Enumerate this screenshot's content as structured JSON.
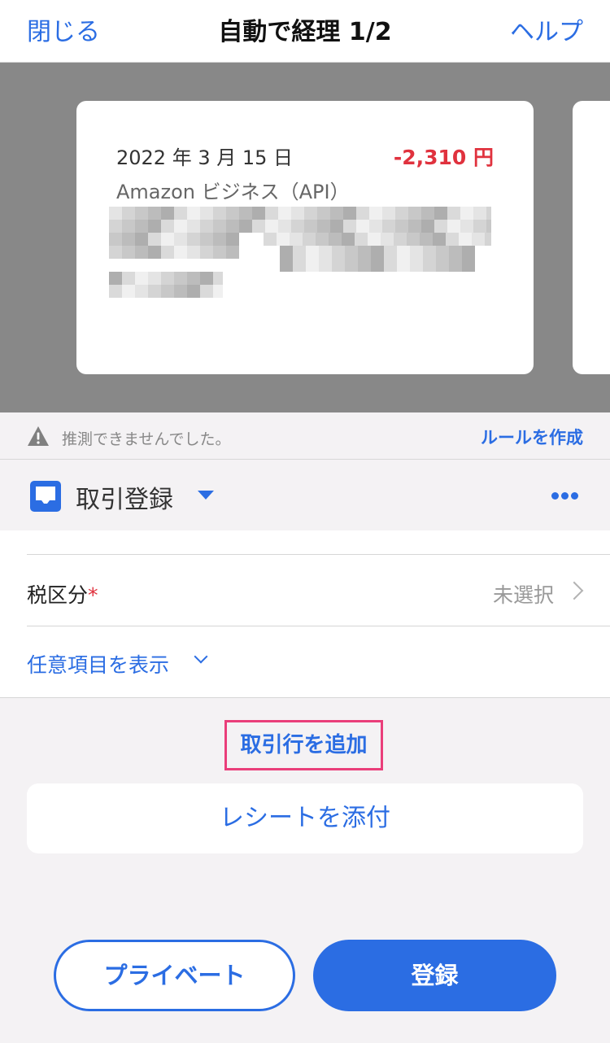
{
  "header": {
    "close_label": "閉じる",
    "title": "自動で経理 1/2",
    "help_label": "ヘルプ"
  },
  "card": {
    "date": "2022 年 3 月 15 日",
    "amount": "-2,310 円",
    "source": "Amazon ビジネス（API）"
  },
  "notice": {
    "icon": "warning-icon",
    "text": "推測できませんでした。",
    "link_label": "ルールを作成"
  },
  "transaction_type": {
    "icon": "inbox-icon",
    "label": "取引登録",
    "more_icon": "more-horizontal-icon"
  },
  "form": {
    "tax_label": "税区分",
    "required_mark": "*",
    "tax_value": "未選択",
    "optional_toggle_label": "任意項目を表示"
  },
  "actions": {
    "add_line_label": "取引行を追加",
    "attach_receipt_label": "レシートを添付",
    "private_label": "プライベート",
    "register_label": "登録"
  },
  "colors": {
    "accent": "#2b6de3",
    "negative_amount": "#e0323e",
    "highlight_box": "#ea3e7a",
    "carousel_bg": "#888888"
  }
}
